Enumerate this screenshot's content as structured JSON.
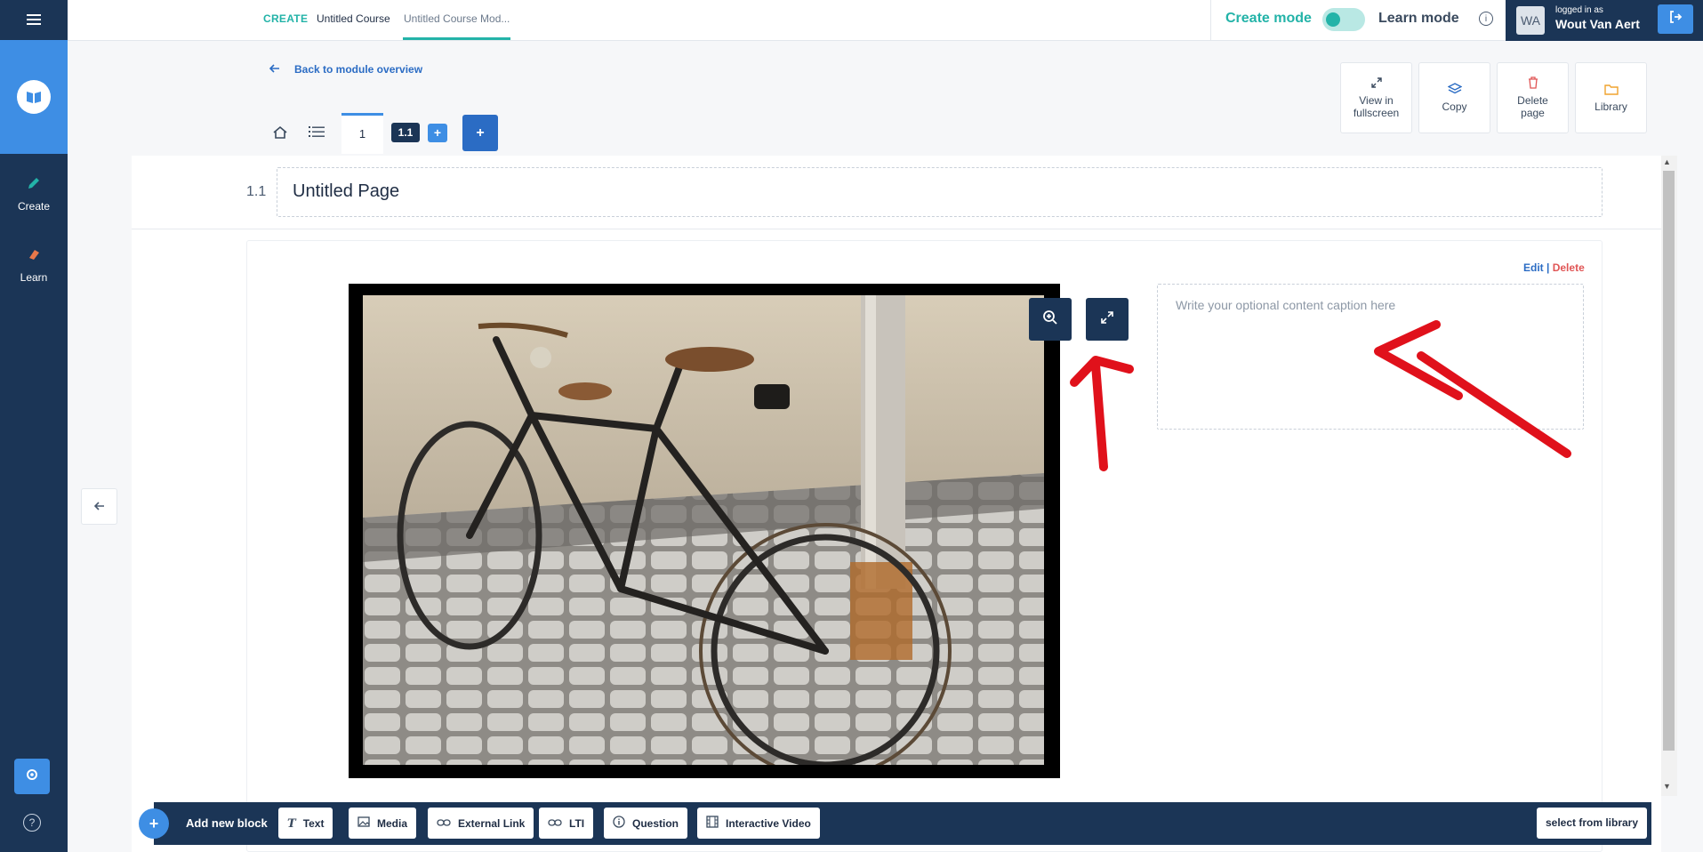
{
  "sidebar": {
    "items": [
      {
        "label": "Create",
        "icon": "pencil-icon"
      },
      {
        "label": "Learn",
        "icon": "eraser-icon"
      }
    ],
    "accent": "#3e8ee4",
    "bg": "#1b3556"
  },
  "header": {
    "breadcrumb": {
      "section": "CREATE",
      "course": "Untitled Course",
      "module": "Untitled Course Mod..."
    },
    "create_mode_label": "Create mode",
    "learn_mode_label": "Learn mode",
    "mode_toggle_on": true,
    "user": {
      "initials": "WA",
      "logged_in_label": "logged in as",
      "name": "Wout Van Aert"
    }
  },
  "nav": {
    "back_label": "Back to module overview",
    "tabs": {
      "page_tab": "1",
      "subpage_tab": "1.1",
      "add_subpage": "+",
      "add_page": "+"
    }
  },
  "actions": [
    {
      "label": "View in fullscreen",
      "icon": "expand-icon"
    },
    {
      "label": "Copy",
      "icon": "layers-icon"
    },
    {
      "label": "Delete page",
      "icon": "trash-icon"
    },
    {
      "label": "Library",
      "icon": "folder-icon"
    }
  ],
  "page": {
    "number": "1.1",
    "title": "Untitled Page"
  },
  "block": {
    "edit_label": "Edit",
    "separator": "|",
    "delete_label": "Delete",
    "caption_placeholder": "Write your optional content caption here",
    "image_subject": "bicycle-photo"
  },
  "toolbar": {
    "add_symbol": "+",
    "add_label": "Add new block",
    "buttons": [
      {
        "label": "Text",
        "icon": "text-icon"
      },
      {
        "label": "Media",
        "icon": "image-icon"
      },
      {
        "label": "External Link",
        "icon": "link-icon"
      },
      {
        "label": "LTI",
        "icon": "link-icon"
      },
      {
        "label": "Question",
        "icon": "info-icon"
      },
      {
        "label": "Interactive Video",
        "icon": "film-icon"
      }
    ],
    "library_label": "select from library"
  },
  "colors": {
    "teal": "#23b3a8",
    "navy": "#1b3556",
    "blue": "#3e8ee4",
    "annotation_red": "#e0111b"
  }
}
